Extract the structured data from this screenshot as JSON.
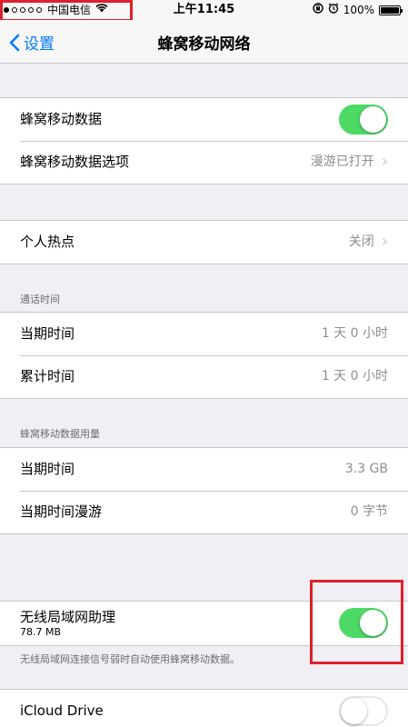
{
  "status_bar": {
    "carrier": "中国电信",
    "time": "上午11:45",
    "battery": "100%",
    "signal_bars": 1,
    "signal_total": 5
  },
  "nav": {
    "back_label": "设置",
    "title": "蜂窝移动网络"
  },
  "cellular_data": {
    "label": "蜂窝移动数据",
    "enabled": true
  },
  "cellular_options": {
    "label": "蜂窝移动数据选项",
    "value": "漫游已打开"
  },
  "hotspot": {
    "label": "个人热点",
    "value": "关闭"
  },
  "call_time": {
    "header": "通话时间",
    "rows": [
      {
        "label": "当期时间",
        "value": "1 天 0 小时"
      },
      {
        "label": "累计时间",
        "value": "1 天 0 小时"
      }
    ]
  },
  "data_usage": {
    "header": "蜂窝移动数据用量",
    "rows": [
      {
        "label": "当期时间",
        "value": "3.3 GB"
      },
      {
        "label": "当期时间漫游",
        "value": "0 字节"
      }
    ]
  },
  "wifi_assist": {
    "label": "无线局域网助理",
    "size": "78.7 MB",
    "enabled": true,
    "footer": "无线局域网连接信号弱时自动使用蜂窝移动数据。"
  },
  "icloud_drive": {
    "label": "iCloud Drive",
    "enabled": false
  },
  "colors": {
    "accent": "#007aff",
    "toggle_on": "#4cd964",
    "highlight": "#e0202a"
  }
}
